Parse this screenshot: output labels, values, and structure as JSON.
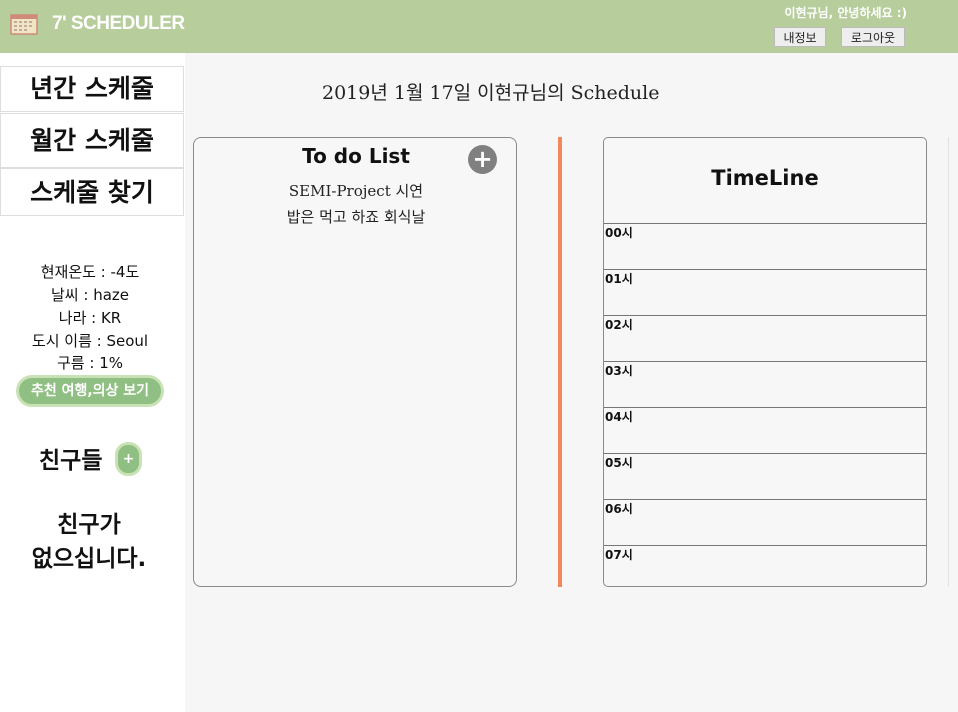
{
  "header": {
    "brand": "7' SCHEDULER",
    "greeting": "이현규님, 안녕하세요 :)",
    "my_info_button": "내정보",
    "logout_button": "로그아웃"
  },
  "sidebar": {
    "menu": [
      {
        "label": "년간 스케줄"
      },
      {
        "label": "월간 스케줄"
      },
      {
        "label": "스케줄 찾기"
      }
    ],
    "weather": {
      "temperature": "현재온도 : -4도",
      "condition": "날씨 : haze",
      "country": "나라 : KR",
      "city": "도시 이름 : Seoul",
      "clouds": "구름 : 1%"
    },
    "recommend_button": "추천 여행,의상 보기",
    "friends_title": "친구들",
    "friends_add": "+",
    "no_friends_line1": "친구가",
    "no_friends_line2": "없으십니다."
  },
  "main": {
    "date_title": "2019년 1월 17일 이현규님의 Schedule",
    "todo": {
      "title": "To do List",
      "add": "+",
      "items": [
        "SEMI-Project 시연",
        "밥은 먹고 하죠 회식날"
      ]
    },
    "timeline": {
      "title": "TimeLine",
      "hours": [
        "00시",
        "01시",
        "02시",
        "03시",
        "04시",
        "05시",
        "06시",
        "07시"
      ]
    }
  },
  "colors": {
    "header_bg": "#b7cd9c",
    "accent_green": "#8fbf82",
    "divider": "#f08a5d"
  }
}
